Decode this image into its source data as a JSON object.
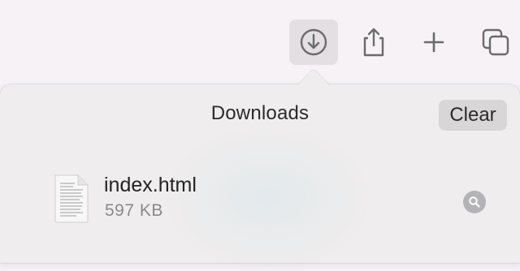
{
  "toolbar": {
    "buttons": [
      {
        "icon": "download-icon",
        "active": true
      },
      {
        "icon": "share-icon"
      },
      {
        "icon": "plus-icon"
      },
      {
        "icon": "tabs-overview-icon"
      }
    ]
  },
  "downloads": {
    "title": "Downloads",
    "clear_label": "Clear",
    "items": [
      {
        "name": "index.html",
        "size": "597 KB",
        "icon": "document-icon",
        "action_icon": "magnifier-icon"
      }
    ]
  }
}
